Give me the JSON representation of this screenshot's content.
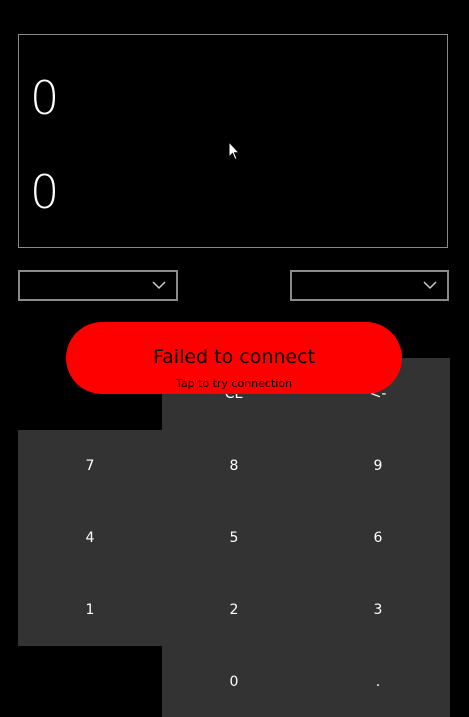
{
  "display": {
    "top_value": "0",
    "bottom_value": "0"
  },
  "dropdowns": {
    "left_selected": "",
    "right_selected": ""
  },
  "keys": {
    "ce": "CE",
    "backspace": "<-",
    "k7": "7",
    "k8": "8",
    "k9": "9",
    "k4": "4",
    "k5": "5",
    "k6": "6",
    "k1": "1",
    "k2": "2",
    "k3": "3",
    "k0": "0",
    "dot": "."
  },
  "toast": {
    "title": "Failed to connect",
    "subtitle": "Tap to try connection"
  },
  "colors": {
    "background": "#000000",
    "key": "#333333",
    "toast": "#ff0000",
    "border": "#8a8a8a"
  },
  "icons": {
    "dropdown": "chevron-down-icon",
    "pointer": "mouse-pointer-icon"
  }
}
